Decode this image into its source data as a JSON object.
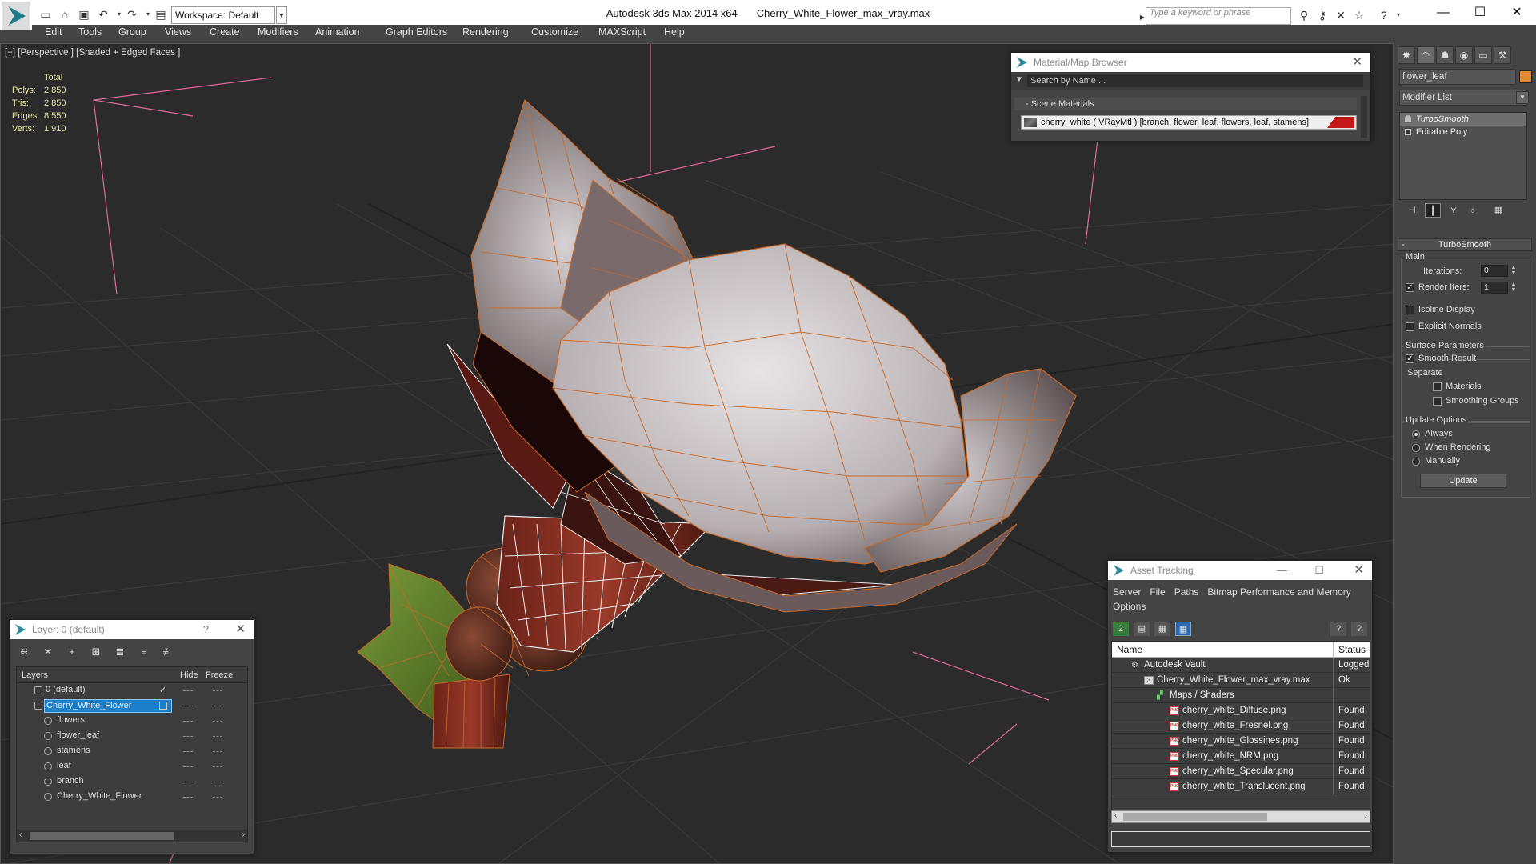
{
  "titlebar": {
    "app_title": "Autodesk 3ds Max  2014 x64",
    "file_title": "Cherry_White_Flower_max_vray.max",
    "workspace": "Workspace: Default",
    "search_placeholder": "Type a keyword or phrase"
  },
  "menu": [
    "Edit",
    "Tools",
    "Group",
    "Views",
    "Create",
    "Modifiers",
    "Animation",
    "Graph Editors",
    "Rendering",
    "Customize",
    "MAXScript",
    "Help"
  ],
  "viewport": {
    "label": "[+] [Perspective ] [Shaded + Edged Faces ]",
    "stats_header": "Total",
    "stats": [
      {
        "key": "Polys:",
        "value": "2 850"
      },
      {
        "key": "Tris:",
        "value": "2 850"
      },
      {
        "key": "Edges:",
        "value": "8 550"
      },
      {
        "key": "Verts:",
        "value": "1 910"
      }
    ]
  },
  "command_panel": {
    "object_name": "flower_leaf",
    "object_color": "#e08a32",
    "modifier_list": "Modifier List",
    "stack": [
      "TurboSmooth",
      "Editable Poly"
    ],
    "rollout_title": "TurboSmooth",
    "main_label": "Main",
    "iterations_label": "Iterations:",
    "iterations_value": "0",
    "render_iters_label": "Render Iters:",
    "render_iters_value": "1",
    "render_iters_checked": true,
    "isoline_label": "Isoline Display",
    "explicit_normals_label": "Explicit Normals",
    "surface_params_label": "Surface Parameters",
    "smooth_result_label": "Smooth Result",
    "separate_label": "Separate",
    "materials_label": "Materials",
    "smoothing_groups_label": "Smoothing Groups",
    "update_options_label": "Update Options",
    "always_label": "Always",
    "when_rendering_label": "When Rendering",
    "manually_label": "Manually",
    "update_button": "Update"
  },
  "material_browser": {
    "title": "Material/Map Browser",
    "search_placeholder": "Search by Name ...",
    "section": "- Scene Materials",
    "item": "cherry_white  ( VRayMtl )  [branch, flower_leaf, flowers, leaf, stamens]",
    "accent": "#c41818"
  },
  "layer_window": {
    "title": "Layer: 0 (default)",
    "col_layers": "Layers",
    "col_hide": "Hide",
    "col_freeze": "Freeze",
    "rows": [
      {
        "name": "0 (default)"
      },
      {
        "name": "Cherry_White_Flower"
      },
      {
        "name": "flowers"
      },
      {
        "name": "flower_leaf"
      },
      {
        "name": "stamens"
      },
      {
        "name": "leaf"
      },
      {
        "name": "branch"
      },
      {
        "name": "Cherry_White_Flower"
      }
    ]
  },
  "asset_tracking": {
    "title": "Asset Tracking",
    "menu": [
      "Server",
      "File",
      "Paths",
      "Bitmap Performance and Memory",
      "Options"
    ],
    "col_name": "Name",
    "col_status": "Status",
    "rows": [
      {
        "name": "Autodesk Vault",
        "status": "Logged O"
      },
      {
        "name": "Cherry_White_Flower_max_vray.max",
        "status": "Ok"
      },
      {
        "name": "Maps / Shaders",
        "status": ""
      },
      {
        "name": "cherry_white_Diffuse.png",
        "status": "Found"
      },
      {
        "name": "cherry_white_Fresnel.png",
        "status": "Found"
      },
      {
        "name": "cherry_white_Glossines.png",
        "status": "Found"
      },
      {
        "name": "cherry_white_NRM.png",
        "status": "Found"
      },
      {
        "name": "cherry_white_Specular.png",
        "status": "Found"
      },
      {
        "name": "cherry_white_Translucent.png",
        "status": "Found"
      }
    ]
  }
}
